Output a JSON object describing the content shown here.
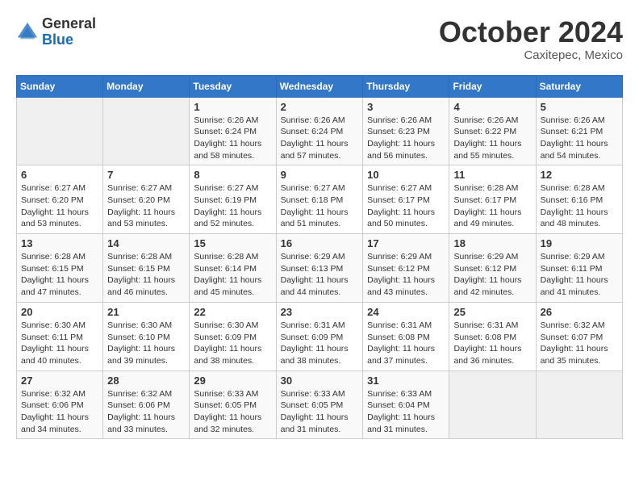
{
  "logo": {
    "general": "General",
    "blue": "Blue"
  },
  "title": {
    "month": "October 2024",
    "location": "Caxitepec, Mexico"
  },
  "headers": [
    "Sunday",
    "Monday",
    "Tuesday",
    "Wednesday",
    "Thursday",
    "Friday",
    "Saturday"
  ],
  "weeks": [
    [
      {
        "day": "",
        "info": ""
      },
      {
        "day": "",
        "info": ""
      },
      {
        "day": "1",
        "info": "Sunrise: 6:26 AM\nSunset: 6:24 PM\nDaylight: 11 hours and 58 minutes."
      },
      {
        "day": "2",
        "info": "Sunrise: 6:26 AM\nSunset: 6:24 PM\nDaylight: 11 hours and 57 minutes."
      },
      {
        "day": "3",
        "info": "Sunrise: 6:26 AM\nSunset: 6:23 PM\nDaylight: 11 hours and 56 minutes."
      },
      {
        "day": "4",
        "info": "Sunrise: 6:26 AM\nSunset: 6:22 PM\nDaylight: 11 hours and 55 minutes."
      },
      {
        "day": "5",
        "info": "Sunrise: 6:26 AM\nSunset: 6:21 PM\nDaylight: 11 hours and 54 minutes."
      }
    ],
    [
      {
        "day": "6",
        "info": "Sunrise: 6:27 AM\nSunset: 6:20 PM\nDaylight: 11 hours and 53 minutes."
      },
      {
        "day": "7",
        "info": "Sunrise: 6:27 AM\nSunset: 6:20 PM\nDaylight: 11 hours and 53 minutes."
      },
      {
        "day": "8",
        "info": "Sunrise: 6:27 AM\nSunset: 6:19 PM\nDaylight: 11 hours and 52 minutes."
      },
      {
        "day": "9",
        "info": "Sunrise: 6:27 AM\nSunset: 6:18 PM\nDaylight: 11 hours and 51 minutes."
      },
      {
        "day": "10",
        "info": "Sunrise: 6:27 AM\nSunset: 6:17 PM\nDaylight: 11 hours and 50 minutes."
      },
      {
        "day": "11",
        "info": "Sunrise: 6:28 AM\nSunset: 6:17 PM\nDaylight: 11 hours and 49 minutes."
      },
      {
        "day": "12",
        "info": "Sunrise: 6:28 AM\nSunset: 6:16 PM\nDaylight: 11 hours and 48 minutes."
      }
    ],
    [
      {
        "day": "13",
        "info": "Sunrise: 6:28 AM\nSunset: 6:15 PM\nDaylight: 11 hours and 47 minutes."
      },
      {
        "day": "14",
        "info": "Sunrise: 6:28 AM\nSunset: 6:15 PM\nDaylight: 11 hours and 46 minutes."
      },
      {
        "day": "15",
        "info": "Sunrise: 6:28 AM\nSunset: 6:14 PM\nDaylight: 11 hours and 45 minutes."
      },
      {
        "day": "16",
        "info": "Sunrise: 6:29 AM\nSunset: 6:13 PM\nDaylight: 11 hours and 44 minutes."
      },
      {
        "day": "17",
        "info": "Sunrise: 6:29 AM\nSunset: 6:12 PM\nDaylight: 11 hours and 43 minutes."
      },
      {
        "day": "18",
        "info": "Sunrise: 6:29 AM\nSunset: 6:12 PM\nDaylight: 11 hours and 42 minutes."
      },
      {
        "day": "19",
        "info": "Sunrise: 6:29 AM\nSunset: 6:11 PM\nDaylight: 11 hours and 41 minutes."
      }
    ],
    [
      {
        "day": "20",
        "info": "Sunrise: 6:30 AM\nSunset: 6:11 PM\nDaylight: 11 hours and 40 minutes."
      },
      {
        "day": "21",
        "info": "Sunrise: 6:30 AM\nSunset: 6:10 PM\nDaylight: 11 hours and 39 minutes."
      },
      {
        "day": "22",
        "info": "Sunrise: 6:30 AM\nSunset: 6:09 PM\nDaylight: 11 hours and 38 minutes."
      },
      {
        "day": "23",
        "info": "Sunrise: 6:31 AM\nSunset: 6:09 PM\nDaylight: 11 hours and 38 minutes."
      },
      {
        "day": "24",
        "info": "Sunrise: 6:31 AM\nSunset: 6:08 PM\nDaylight: 11 hours and 37 minutes."
      },
      {
        "day": "25",
        "info": "Sunrise: 6:31 AM\nSunset: 6:08 PM\nDaylight: 11 hours and 36 minutes."
      },
      {
        "day": "26",
        "info": "Sunrise: 6:32 AM\nSunset: 6:07 PM\nDaylight: 11 hours and 35 minutes."
      }
    ],
    [
      {
        "day": "27",
        "info": "Sunrise: 6:32 AM\nSunset: 6:06 PM\nDaylight: 11 hours and 34 minutes."
      },
      {
        "day": "28",
        "info": "Sunrise: 6:32 AM\nSunset: 6:06 PM\nDaylight: 11 hours and 33 minutes."
      },
      {
        "day": "29",
        "info": "Sunrise: 6:33 AM\nSunset: 6:05 PM\nDaylight: 11 hours and 32 minutes."
      },
      {
        "day": "30",
        "info": "Sunrise: 6:33 AM\nSunset: 6:05 PM\nDaylight: 11 hours and 31 minutes."
      },
      {
        "day": "31",
        "info": "Sunrise: 6:33 AM\nSunset: 6:04 PM\nDaylight: 11 hours and 31 minutes."
      },
      {
        "day": "",
        "info": ""
      },
      {
        "day": "",
        "info": ""
      }
    ]
  ]
}
